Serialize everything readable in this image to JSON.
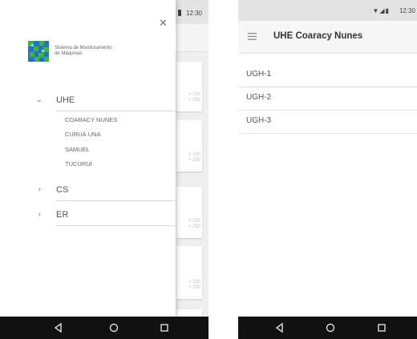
{
  "left": {
    "status_time": "12:30",
    "drawer": {
      "close_icon": "close-icon",
      "logo_text_line1": "Sistema de Monitoramento",
      "logo_text_line2": "de Máquinas",
      "groups": [
        {
          "label": "UHE",
          "expanded": true,
          "items": [
            "COARACY NUNES",
            "CURUÁ UNA",
            "SAMUEL",
            "TUCURUÍ"
          ]
        },
        {
          "label": "CS",
          "expanded": false
        },
        {
          "label": "ER",
          "expanded": false
        }
      ]
    },
    "background_cards": [
      {
        "limit_hi": "> 150",
        "limit_lo": "< 250"
      },
      {
        "limit_hi": "> 150",
        "limit_lo": "< 250"
      },
      {
        "limit_hi": "> 150",
        "limit_lo": "< 250"
      },
      {
        "limit_hi": "> 150",
        "limit_lo": "< 250"
      }
    ]
  },
  "right": {
    "status_time": "12:30",
    "title": "UHE Coaracy Nunes",
    "units": [
      "UGH-1",
      "UGH-2",
      "UGH-3"
    ]
  },
  "nav": {
    "back": "back-icon",
    "home": "home-icon",
    "recents": "recents-icon"
  },
  "colors": {
    "status_bar": "#e4e4e4",
    "nav_bar": "#111111",
    "logo_blue": "#2a6fc4",
    "logo_green": "#3db34a"
  }
}
